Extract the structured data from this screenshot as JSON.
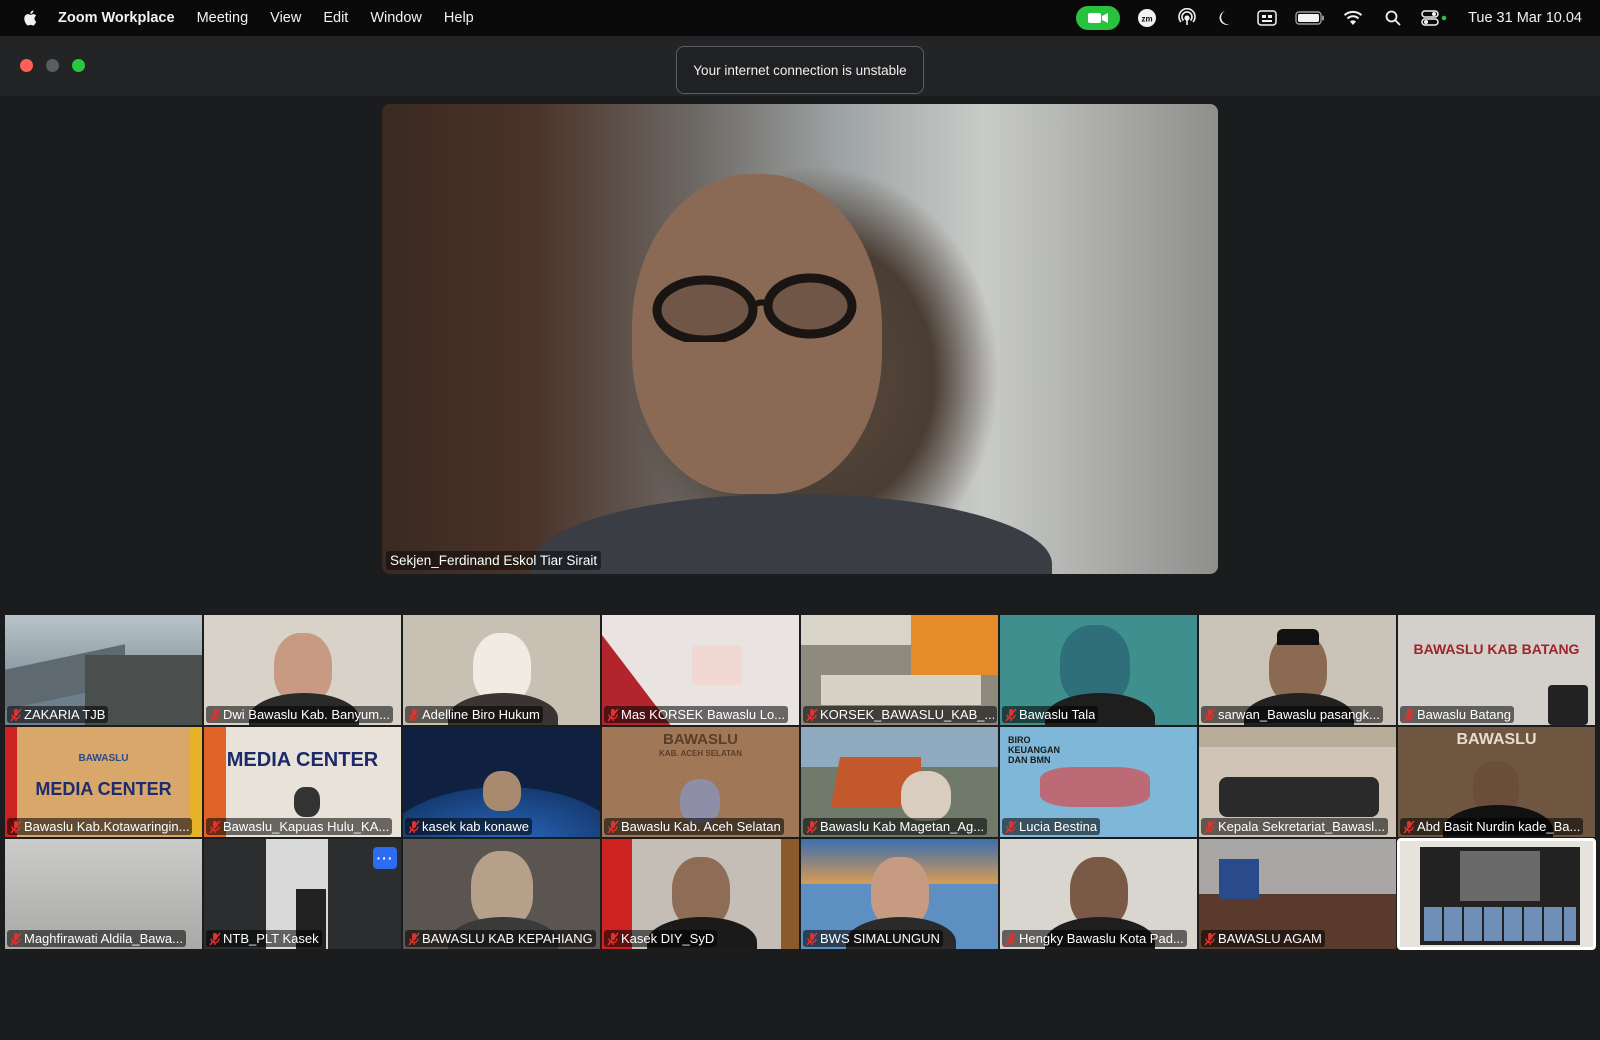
{
  "menubar": {
    "app_name": "Zoom Workplace",
    "menus": [
      "Meeting",
      "View",
      "Edit",
      "Window",
      "Help"
    ],
    "clock": "Tue 31 Mar  10.04"
  },
  "toast": {
    "message": "Your internet connection is unstable"
  },
  "speaker": {
    "name": "Sekjen_Ferdinand Eskol Tiar Sirait"
  },
  "tiles_banner": {
    "batang": "BAWASLU KAB BATANG",
    "media_center": "MEDIA CENTER",
    "media_center2": "MEDIA CENTER",
    "bawaslu": "BAWASLU",
    "aceh": "KAB. ACEH SELATAN",
    "biro": "BIRO KEUANGAN DAN BMN",
    "bawaslu_small": "BAWASLU"
  },
  "participants": [
    {
      "name": "ZAKARIA TJB",
      "bg": "#6d7f8c"
    },
    {
      "name": "Dwi Bawaslu Kab. Banyum...",
      "bg": "#d8d2c8"
    },
    {
      "name": "Adelline Biro Hukum",
      "bg": "#c9c0b4"
    },
    {
      "name": "Mas KORSEK Bawaslu Lo...",
      "bg": "#e9e3e2"
    },
    {
      "name": "KORSEK_BAWASLU_KAB_...",
      "bg": "#8f8a7e"
    },
    {
      "name": "Bawaslu Tala",
      "bg": "#3f8f8f"
    },
    {
      "name": "sarwan_Bawaslu pasangk...",
      "bg": "#c9c3b8"
    },
    {
      "name": "Bawaslu Batang",
      "bg": "#d3d0cc"
    },
    {
      "name": "Bawaslu Kab.Kotawaringin...",
      "bg": "#d9a76a"
    },
    {
      "name": "Bawaslu_Kapuas Hulu_KA...",
      "bg": "#e8e2d8"
    },
    {
      "name": "kasek kab konawe",
      "bg": "#102040"
    },
    {
      "name": "Bawaslu Kab. Aceh Selatan",
      "bg": "#a07858"
    },
    {
      "name": "Bawaslu Kab Magetan_Ag...",
      "bg": "#6f7a6a"
    },
    {
      "name": "Lucia Bestina",
      "bg": "#7fb7d8"
    },
    {
      "name": "Kepala Sekretariat_Bawasl...",
      "bg": "#cfc4b6"
    },
    {
      "name": "Abd Basit Nurdin kade_Ba...",
      "bg": "#6f5640"
    },
    {
      "name": "Maghfirawati Aldila_Bawa...",
      "bg": "#b8b8b6"
    },
    {
      "name": "NTB_PLT Kasek",
      "bg": "#2c2d2f"
    },
    {
      "name": "BAWASLU KAB KEPAHIANG",
      "bg": "#5a5550"
    },
    {
      "name": "Kasek DIY_SyD",
      "bg": "#c4beb6"
    },
    {
      "name": "BWS SIMALUNGUN",
      "bg": "#4f7aa8"
    },
    {
      "name": "Hengky Bawaslu Kota Pad...",
      "bg": "#d9d6d0"
    },
    {
      "name": "BAWASLU AGAM",
      "bg": "#a9a7a6"
    },
    {
      "name": "",
      "bg": "#e6e2dc"
    }
  ],
  "colors": {
    "accent_green": "#29c23e",
    "muted_mic": "#e0322f",
    "more_button": "#2d6cf0"
  }
}
